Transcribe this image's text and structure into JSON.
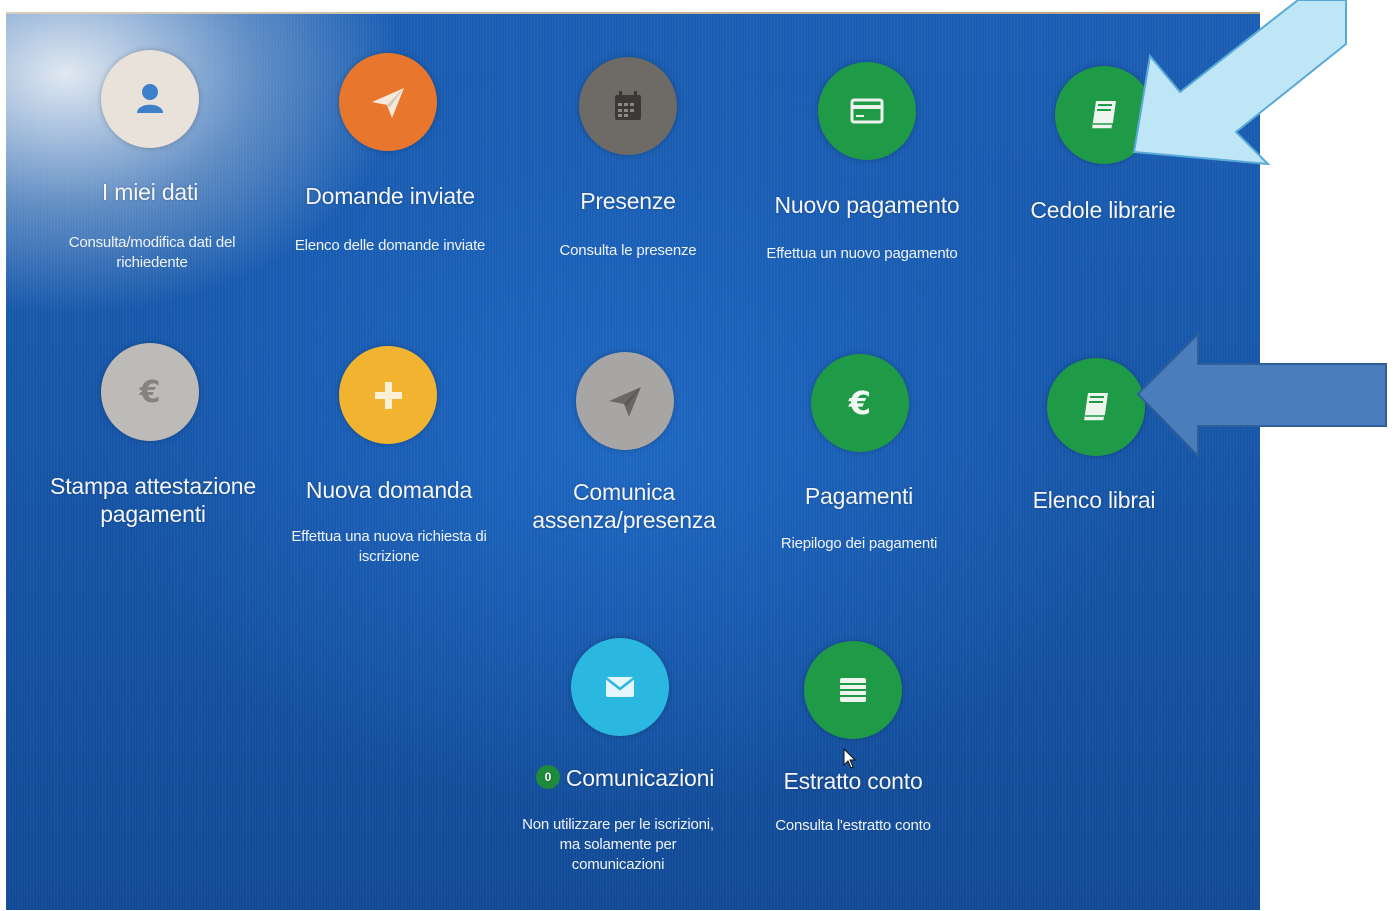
{
  "colors": {
    "user": "#e8e2da",
    "user_icon": "#3d7fc8",
    "orange": "#e8772d",
    "dark_grey": "#6e6a66",
    "green": "#1f9a47",
    "grey": "#bdbbb8",
    "yellow": "#f2b430",
    "mid_grey": "#a8a6a4",
    "cyan": "#2bb8e0",
    "arrow_light": "#bfe6f7",
    "arrow_dark": "#4a7dbb"
  },
  "tiles": {
    "miei_dati": {
      "icon": "user-icon",
      "title": "I miei dati",
      "desc": "Consulta/modifica dati del richiedente"
    },
    "domande_inviate": {
      "icon": "paper-plane-icon",
      "title": "Domande inviate",
      "desc": "Elenco delle domande inviate"
    },
    "presenze": {
      "icon": "calendar-icon",
      "title": "Presenze",
      "desc": "Consulta le presenze"
    },
    "nuovo_pagamento": {
      "icon": "credit-card-icon",
      "title": "Nuovo pagamento",
      "desc": "Effettua un nuovo pagamento"
    },
    "cedole_librarie": {
      "icon": "book-icon",
      "title": "Cedole librarie",
      "desc": ""
    },
    "stampa_attestazione": {
      "icon": "euro-icon",
      "title": "Stampa attestazione pagamenti",
      "desc": ""
    },
    "nuova_domanda": {
      "icon": "plus-icon",
      "title": "Nuova domanda",
      "desc": "Effettua una nuova richiesta di iscrizione"
    },
    "comunica_assenza": {
      "icon": "paper-plane-icon",
      "title": "Comunica assenza/presenza",
      "desc": ""
    },
    "pagamenti": {
      "icon": "euro-icon",
      "title": "Pagamenti",
      "desc": "Riepilogo dei pagamenti"
    },
    "elenco_librai": {
      "icon": "book-icon",
      "title": "Elenco librai",
      "desc": ""
    },
    "comunicazioni": {
      "icon": "envelope-icon",
      "badge": "0",
      "title": "Comunicazioni",
      "desc": "Non utilizzare per le iscrizioni, ma solamente per comunicazioni"
    },
    "estratto_conto": {
      "icon": "list-icon",
      "title": "Estratto conto",
      "desc": "Consulta l'estratto conto"
    }
  }
}
